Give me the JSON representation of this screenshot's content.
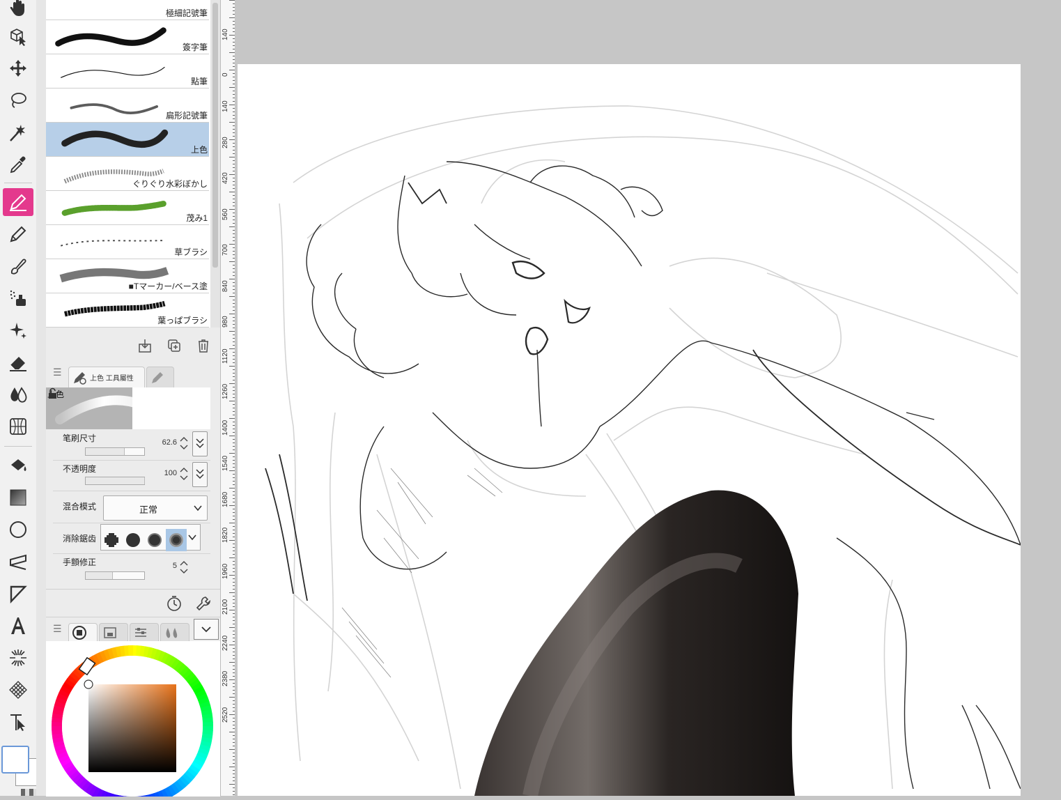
{
  "tools": [
    "hand-icon",
    "object-select-icon",
    "move-icon",
    "lasso-icon",
    "magic-wand-icon",
    "eyedropper-icon",
    "pen-icon",
    "pencil-icon",
    "brush-icon",
    "airbrush-icon",
    "decoration-icon",
    "eraser-icon",
    "blend-icon",
    "perspective-icon",
    "fill-icon",
    "gradient-icon",
    "shape-icon",
    "frame-icon",
    "ruler-icon",
    "text-icon",
    "effect-line-icon",
    "pattern-icon",
    "correct-line-icon"
  ],
  "active_tool": "pen-icon",
  "brushes": [
    {
      "name": "極細記號筆",
      "stroke": "marker",
      "color": "#111111"
    },
    {
      "name": "簽字筆",
      "stroke": "thick",
      "color": "#111111"
    },
    {
      "name": "點筆",
      "stroke": "thin",
      "color": "#111111"
    },
    {
      "name": "扁形記號筆",
      "stroke": "flat",
      "color": "#333333"
    },
    {
      "name": "上色",
      "stroke": "soft",
      "color": "#222222"
    },
    {
      "name": "ぐりぐり水彩ぼかし",
      "stroke": "texture",
      "color": "#888888"
    },
    {
      "name": "茂み1",
      "stroke": "bush",
      "color": "#5aa02c"
    },
    {
      "name": "草ブラシ",
      "stroke": "grass",
      "color": "#444444"
    },
    {
      "name": "■Tマーカー/ベース塗",
      "stroke": "marker-base",
      "color": "#777777"
    },
    {
      "name": "葉っぱブラシ",
      "stroke": "leaf",
      "color": "#111111"
    }
  ],
  "selected_brush": "上色",
  "brush_footer": [
    "import-icon",
    "duplicate-icon",
    "trash-icon"
  ],
  "ruler_labels": [
    "140",
    "0",
    "140",
    "280",
    "420",
    "560",
    "700",
    "840",
    "980",
    "1120",
    "1260",
    "1400",
    "1540",
    "1680",
    "1820",
    "1960",
    "2100",
    "2240",
    "2380",
    "2520"
  ],
  "tool_property": {
    "tab_label": "上色 工具屬性",
    "preview_label": "上色",
    "brush_size": {
      "label": "笔刷尺寸",
      "value": "62.6",
      "fraction": 0.65
    },
    "opacity": {
      "label": "不透明度",
      "value": "100",
      "fraction": 1.0
    },
    "blend_mode": {
      "label": "混合模式",
      "value": "正常"
    },
    "anti_alias": {
      "label": "消除鋸齿",
      "options": [
        "none-icon",
        "weak-icon",
        "medium-icon",
        "strong-icon"
      ],
      "selected": 3
    },
    "stabilization": {
      "label": "手顫修正",
      "value": "5",
      "fraction": 0.45
    }
  },
  "color": {
    "wheel_hue": "orange",
    "main_color": "#ffffff",
    "sub_color": "#ffffff",
    "swatch_square_top_right": "#e8731a"
  }
}
